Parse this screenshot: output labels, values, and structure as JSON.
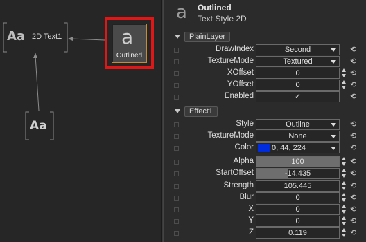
{
  "graph": {
    "nodes": [
      {
        "id": "text1",
        "glyph": "Aa",
        "label": "2D Text1"
      },
      {
        "id": "text2",
        "glyph": "Aa",
        "label": ""
      },
      {
        "id": "outlined",
        "glyph": "a",
        "label": "Outlined"
      }
    ]
  },
  "header": {
    "title": "Outlined",
    "subtitle": "Text Style 2D",
    "icon": "text-style-icon"
  },
  "sections": [
    {
      "label": "PlainLayer",
      "rows": [
        {
          "name": "DrawIndex",
          "value": "Second",
          "kind": "dropdown"
        },
        {
          "name": "TextureMode",
          "value": "Textured",
          "kind": "dropdown"
        },
        {
          "name": "XOffset",
          "value": "0",
          "kind": "spinner"
        },
        {
          "name": "YOffset",
          "value": "0",
          "kind": "spinner"
        },
        {
          "name": "Enabled",
          "value": "✓",
          "kind": "checkbox"
        }
      ]
    },
    {
      "label": "Effect1",
      "rows": [
        {
          "name": "Style",
          "value": "Outline",
          "kind": "dropdown"
        },
        {
          "name": "TextureMode",
          "value": "None",
          "kind": "dropdown"
        },
        {
          "name": "Color",
          "value": "0, 44, 224",
          "kind": "color",
          "swatch": "#002ce0"
        },
        {
          "name": "Alpha",
          "value": "100",
          "kind": "slider",
          "fill": 1.0
        },
        {
          "name": "StartOffset",
          "value": "-14.435",
          "kind": "slider",
          "fill": 0.38
        },
        {
          "name": "Strength",
          "value": "105.445",
          "kind": "spinner"
        },
        {
          "name": "Blur",
          "value": "0",
          "kind": "spinner"
        },
        {
          "name": "X",
          "value": "0",
          "kind": "spinner"
        },
        {
          "name": "Y",
          "value": "0",
          "kind": "spinner"
        },
        {
          "name": "Z",
          "value": "0.119",
          "kind": "spinner"
        }
      ]
    }
  ],
  "colors": {
    "highlight": "#e01717",
    "node_border": "#c88a3a",
    "swatch": "#002ce0"
  },
  "reset_glyph": "⟲"
}
